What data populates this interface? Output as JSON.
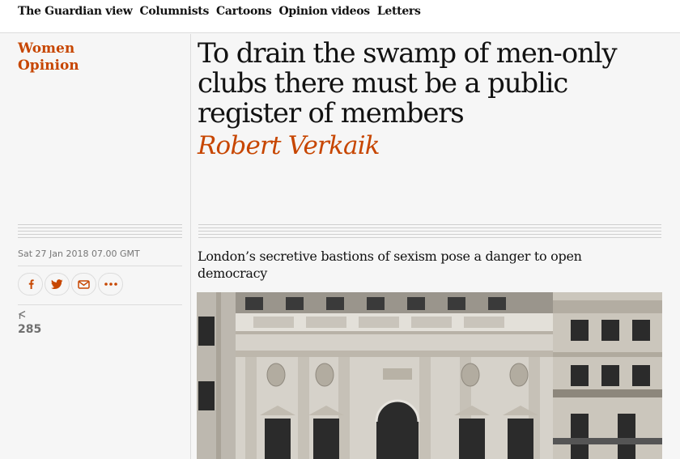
{
  "nav": {
    "items": [
      "The Guardian view",
      "Columnists",
      "Cartoons",
      "Opinion videos",
      "Letters"
    ]
  },
  "article": {
    "section": "Women",
    "series": "Opinion",
    "headline": "To drain the swamp of men-only clubs there must be a public register of members",
    "byline": "Robert Verkaik",
    "standfirst": "London’s secretive bastions of sexism pose a danger to open democracy",
    "dateline": "Sat 27 Jan 2018 07.00 GMT",
    "comment_count": "285"
  },
  "share": {
    "icons": [
      "facebook-icon",
      "twitter-icon",
      "email-icon",
      "more-icon"
    ]
  },
  "colors": {
    "accent": "#c74600",
    "background": "#f6f6f6",
    "rule": "#dcdcdc"
  }
}
